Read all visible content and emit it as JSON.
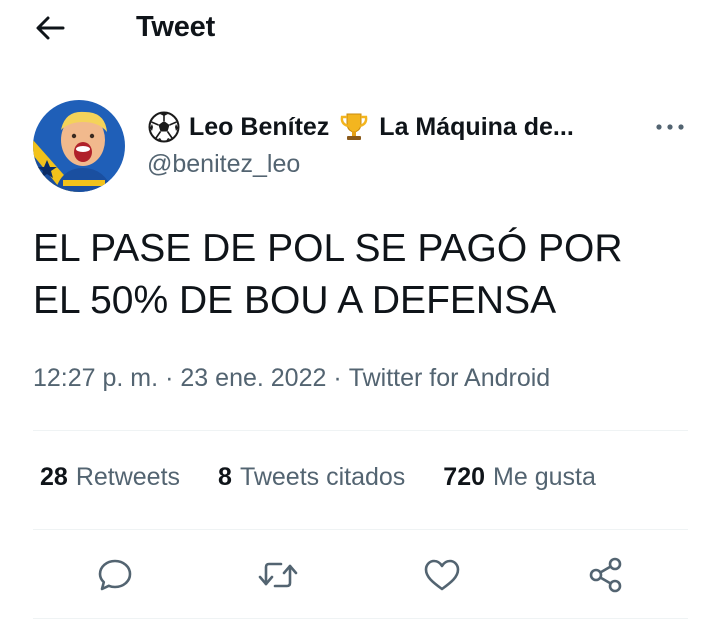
{
  "header": {
    "title": "Tweet",
    "back_icon": "arrow-left-icon"
  },
  "author": {
    "name_prefix_emoji": "soccer-ball-icon",
    "name_first": "Leo Benítez",
    "name_emoji": "trophy-icon",
    "name_rest": "La Máquina de...",
    "handle": "@benitez_leo",
    "more_icon": "more-horizontal-icon"
  },
  "tweet": {
    "text_line1": "EL PASE DE POL SE PAGÓ POR",
    "text_line2": "EL 50% DE BOU A DEFENSA"
  },
  "meta": {
    "time": "12:27 p. m.",
    "separator": "·",
    "date": "23 ene. 2022",
    "source": "Twitter for Android"
  },
  "stats": {
    "retweets_count": "28",
    "retweets_label": "Retweets",
    "quotes_count": "8",
    "quotes_label": "Tweets citados",
    "likes_count": "720",
    "likes_label": "Me gusta"
  },
  "actions": [
    "reply-icon",
    "retweet-icon",
    "like-icon",
    "share-icon"
  ],
  "colors": {
    "text": "#0f1419",
    "secondary": "#536471",
    "divider": "#eff3f4"
  }
}
